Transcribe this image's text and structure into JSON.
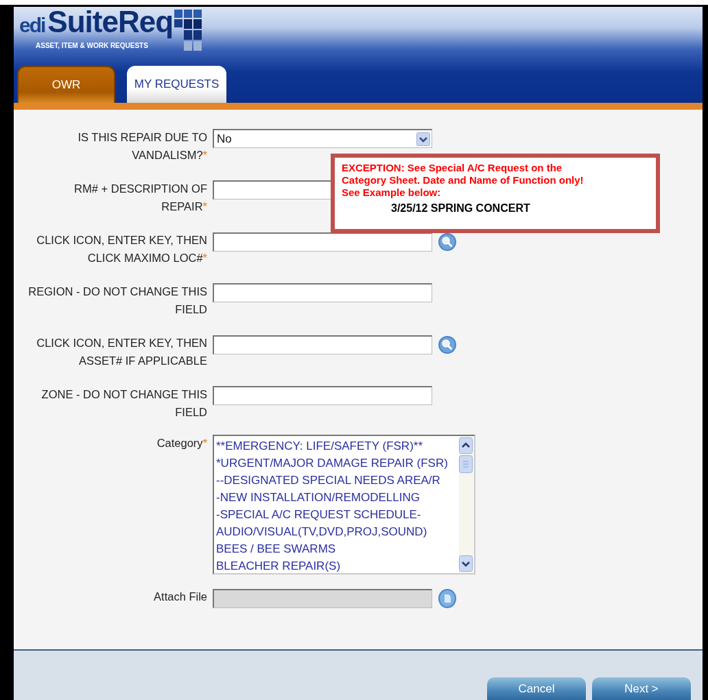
{
  "logo": {
    "prefix": "edi",
    "name": "SuiteReq",
    "tagline": "ASSET, ITEM & WORK REQUESTS"
  },
  "tabs": [
    {
      "label": "OWR",
      "selected": true
    },
    {
      "label": "MY REQUESTS",
      "selected": false
    }
  ],
  "fields": [
    {
      "kind": "dropdown",
      "label_lines": [
        "IS THIS REPAIR DUE TO",
        "VANDALISM?"
      ],
      "required_mark": "*",
      "value": "No"
    },
    {
      "kind": "text",
      "label_lines": [
        "RM# + DESCRIPTION OF",
        "REPAIR"
      ],
      "required_mark": "*"
    },
    {
      "kind": "lookup",
      "label_lines": [
        "CLICK ICON, ENTER KEY, THEN",
        "CLICK MAXIMO LOC#"
      ],
      "required_mark": "*"
    },
    {
      "kind": "text",
      "label_lines": [
        "REGION - DO NOT CHANGE THIS",
        "FIELD"
      ]
    },
    {
      "kind": "lookup",
      "label_lines": [
        "CLICK ICON, ENTER KEY, THEN",
        "ASSET# IF APPLICABLE"
      ]
    },
    {
      "kind": "text",
      "label_lines": [
        "ZONE - DO NOT CHANGE THIS",
        "FIELD"
      ]
    },
    {
      "kind": "listbox",
      "label_lines": [
        "Category"
      ],
      "required_mark": "*",
      "options": [
        "**EMERGENCY: LIFE/SAFETY (FSR)**",
        "*URGENT/MAJOR DAMAGE REPAIR (FSR)",
        "--DESIGNATED SPECIAL NEEDS AREA/R",
        "-NEW INSTALLATION/REMODELLING",
        "-SPECIAL A/C REQUEST SCHEDULE-",
        "AUDIO/VISUAL(TV,DVD,PROJ,SOUND)",
        "BEES / BEE SWARMS",
        "BLEACHER REPAIR(S)"
      ]
    },
    {
      "kind": "file",
      "label_lines": [
        "Attach File"
      ],
      "disabled": true
    }
  ],
  "notice": {
    "lines": [
      "EXCEPTION:  See Special A/C Request on the",
      "Category Sheet.  Date and Name of Function only!",
      "See Example below:"
    ],
    "example": "3/25/12  SPRING CONCERT"
  },
  "buttons": [
    {
      "label": "Cancel"
    },
    {
      "label": "Next >"
    }
  ]
}
